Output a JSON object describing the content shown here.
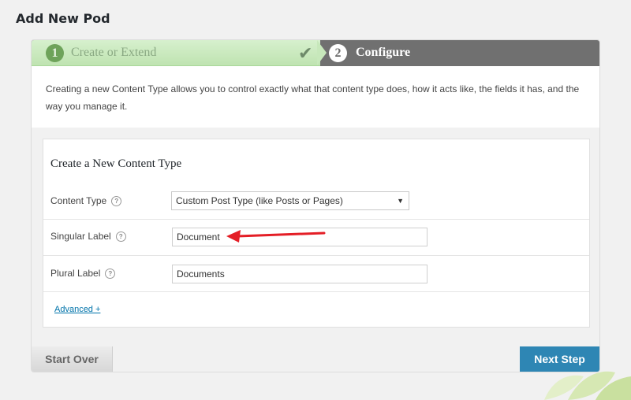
{
  "page": {
    "title": "Add New Pod"
  },
  "steps": [
    {
      "number": "1",
      "label": "Create or Extend",
      "status": "complete"
    },
    {
      "number": "2",
      "label": "Configure",
      "status": "active"
    }
  ],
  "intro": {
    "text": "Creating a new Content Type allows you to control exactly what that content type does, how it acts like, the fields it has, and the way you manage it."
  },
  "form": {
    "title": "Create a New Content Type",
    "content_type": {
      "label": "Content Type",
      "value": "Custom Post Type (like Posts or Pages)"
    },
    "singular_label": {
      "label": "Singular Label",
      "value": "Document"
    },
    "plural_label": {
      "label": "Plural Label",
      "value": "Documents"
    },
    "advanced_link": "Advanced +"
  },
  "footer": {
    "start_over": "Start Over",
    "next_step": "Next Step"
  },
  "icons": {
    "check": "checkmark-icon",
    "help": "help-icon",
    "dropdown": "chevron-down-icon"
  },
  "colors": {
    "step_done": "#c7e8bb",
    "step_active": "#707070",
    "next_button": "#2e86b4",
    "annotation_arrow": "#e41e26"
  }
}
